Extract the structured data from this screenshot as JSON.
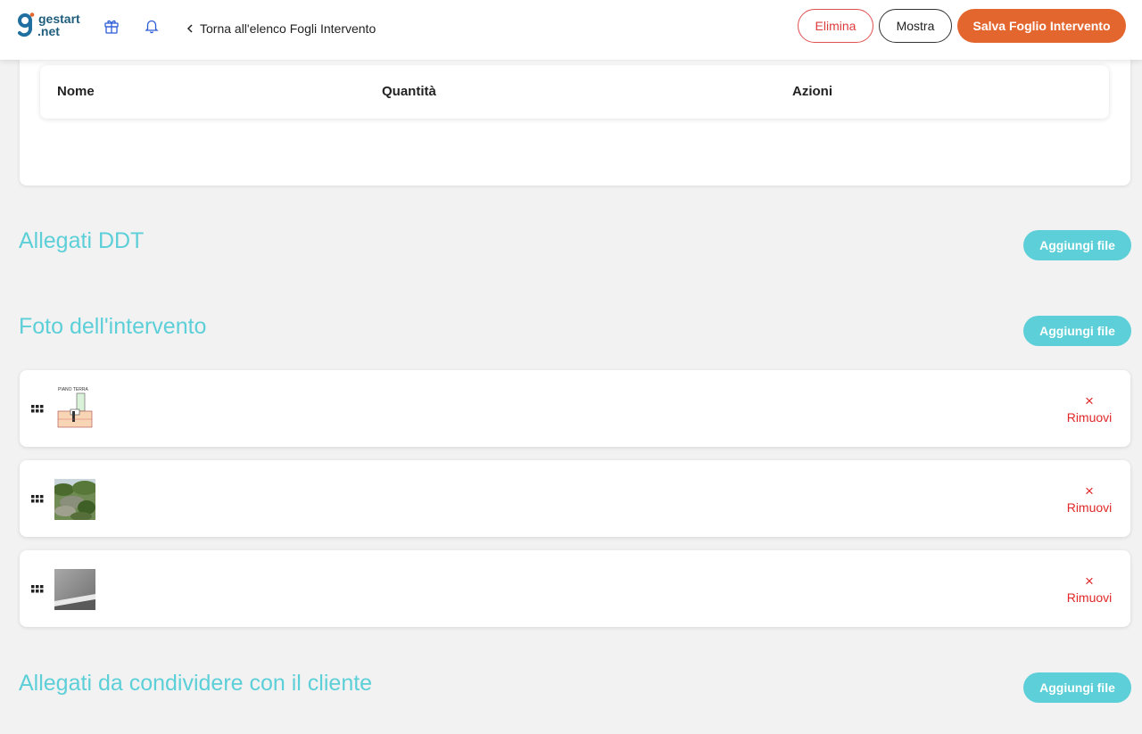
{
  "header": {
    "logo_line1": "gestart",
    "logo_line2": ".net",
    "back_label": "Torna all'elenco Fogli Intervento",
    "buttons": {
      "delete": "Elimina",
      "show": "Mostra",
      "save": "Salva Foglio Intervento"
    },
    "icons": [
      "gift-icon",
      "bell-icon",
      "chevron-left-icon"
    ]
  },
  "table": {
    "columns": [
      "Nome",
      "Quantità",
      "Azioni"
    ]
  },
  "sections": {
    "ddt": {
      "title": "Allegati DDT",
      "add_label": "Aggiungi file"
    },
    "photos": {
      "title": "Foto dell'intervento",
      "add_label": "Aggiungi file"
    },
    "shared": {
      "title": "Allegati da condividere con il cliente",
      "add_label": "Aggiungi file"
    }
  },
  "photos": [
    {
      "thumb": "floor-plan-thumbnail",
      "thumb_caption": "PIANO TERRA",
      "remove_label": "Rimuovi"
    },
    {
      "thumb": "garden-photo-thumbnail",
      "remove_label": "Rimuovi"
    },
    {
      "thumb": "gray-wall-photo-thumbnail",
      "remove_label": "Rimuovi"
    }
  ],
  "colors": {
    "accent": "#5ccfd8",
    "primary": "#e4662f",
    "danger": "#e02828",
    "background": "#f2f2f2"
  }
}
